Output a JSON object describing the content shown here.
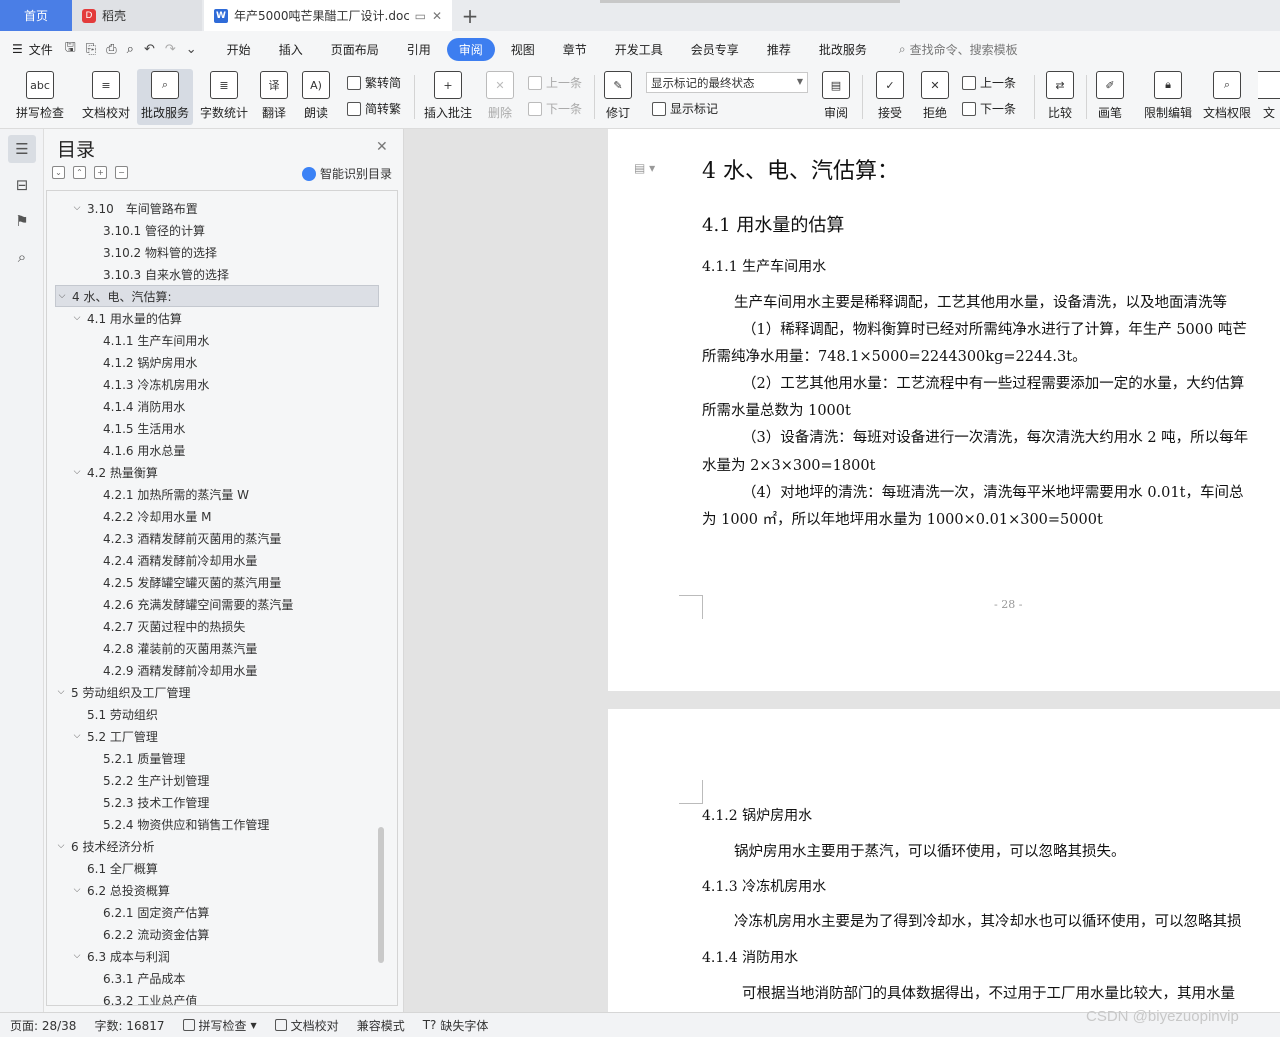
{
  "tabs": {
    "home": "首页",
    "docer": "稻壳",
    "doc": "年产5000吨芒果醋工厂设计.doc"
  },
  "menubar": {
    "file": "文件",
    "items": [
      "开始",
      "插入",
      "页面布局",
      "引用",
      "审阅",
      "视图",
      "章节",
      "开发工具",
      "会员专享",
      "推荐",
      "批改服务"
    ],
    "active": "审阅",
    "search": "查找命令、搜索模板"
  },
  "ribbon": {
    "spell_check": "拼写检查",
    "doc_proof": "文档校对",
    "review_service": "批改服务",
    "word_count": "字数统计",
    "translate": "翻译",
    "read_aloud": "朗读",
    "trad_convert": "繁转简",
    "simp_convert": "简转繁",
    "insert_comment": "插入批注",
    "delete": "删除",
    "prev_comment": "上一条",
    "next_comment": "下一条",
    "track_changes": "修订",
    "markup_state": "显示标记的最终状态",
    "show_markup": "显示标记",
    "review": "审阅",
    "accept": "接受",
    "reject": "拒绝",
    "prev_change": "上一条",
    "next_change": "下一条",
    "compare": "比较",
    "pen": "画笔",
    "restrict_edit": "限制编辑",
    "doc_permission": "文档权限",
    "doc_more": "文"
  },
  "toc": {
    "title": "目录",
    "smart": "智能识别目录",
    "items": [
      {
        "level": 2,
        "caret": "v",
        "text": "3.10　车间管路布置"
      },
      {
        "level": 3,
        "caret": "",
        "text": "3.10.1 管径的计算"
      },
      {
        "level": 3,
        "caret": "",
        "text": "3.10.2 物料管的选择"
      },
      {
        "level": 3,
        "caret": "",
        "text": "3.10.3 自来水管的选择"
      },
      {
        "level": 1,
        "caret": "v",
        "text": "4 水、电、汽估算:",
        "selected": true
      },
      {
        "level": 2,
        "caret": "v",
        "text": "4.1 用水量的估算"
      },
      {
        "level": 3,
        "caret": "",
        "text": "4.1.1 生产车间用水"
      },
      {
        "level": 3,
        "caret": "",
        "text": "4.1.2 锅炉房用水"
      },
      {
        "level": 3,
        "caret": "",
        "text": "4.1.3 冷冻机房用水"
      },
      {
        "level": 3,
        "caret": "",
        "text": "4.1.4 消防用水"
      },
      {
        "level": 3,
        "caret": "",
        "text": "4.1.5 生活用水"
      },
      {
        "level": 3,
        "caret": "",
        "text": "4.1.6 用水总量"
      },
      {
        "level": 2,
        "caret": "v",
        "text": "4.2 热量衡算"
      },
      {
        "level": 3,
        "caret": "",
        "text": "4.2.1 加热所需的蒸汽量 W"
      },
      {
        "level": 3,
        "caret": "",
        "text": "4.2.2 冷却用水量 M"
      },
      {
        "level": 3,
        "caret": "",
        "text": "4.2.3 酒精发酵前灭菌用的蒸汽量"
      },
      {
        "level": 3,
        "caret": "",
        "text": "4.2.4 酒精发酵前冷却用水量"
      },
      {
        "level": 3,
        "caret": "",
        "text": "4.2.5 发酵罐空罐灭菌的蒸汽用量"
      },
      {
        "level": 3,
        "caret": "",
        "text": "4.2.6 充满发酵罐空间需要的蒸汽量"
      },
      {
        "level": 3,
        "caret": "",
        "text": "4.2.7 灭菌过程中的热损失"
      },
      {
        "level": 3,
        "caret": "",
        "text": "4.2.8 灌装前的灭菌用蒸汽量"
      },
      {
        "level": 3,
        "caret": "",
        "text": "4.2.9 酒精发酵前冷却用水量"
      },
      {
        "level": 1,
        "caret": "v",
        "text": "5 劳动组织及工厂管理"
      },
      {
        "level": 2,
        "caret": "",
        "text": "5.1 劳动组织"
      },
      {
        "level": 2,
        "caret": "v",
        "text": "5.2 工厂管理"
      },
      {
        "level": 3,
        "caret": "",
        "text": "5.2.1 质量管理"
      },
      {
        "level": 3,
        "caret": "",
        "text": "5.2.2 生产计划管理"
      },
      {
        "level": 3,
        "caret": "",
        "text": "5.2.3 技术工作管理"
      },
      {
        "level": 3,
        "caret": "",
        "text": "5.2.4 物资供应和销售工作管理"
      },
      {
        "level": 1,
        "caret": "v",
        "text": "6 技术经济分析"
      },
      {
        "level": 2,
        "caret": "",
        "text": "6.1 全厂概算"
      },
      {
        "level": 2,
        "caret": "v",
        "text": "6.2 总投资概算"
      },
      {
        "level": 3,
        "caret": "",
        "text": "6.2.1 固定资产估算"
      },
      {
        "level": 3,
        "caret": "",
        "text": "6.2.2 流动资金估算"
      },
      {
        "level": 2,
        "caret": "v",
        "text": "6.3 成本与利润"
      },
      {
        "level": 3,
        "caret": "",
        "text": "6.3.1 产品成本"
      },
      {
        "level": 3,
        "caret": "",
        "text": "6.3.2 工业总产值"
      }
    ]
  },
  "doc": {
    "page1": {
      "h1": "4  水、电、汽估算：",
      "h2": "4.1 用水量的估算",
      "h3": "4.1.1 生产车间用水",
      "lines": [
        "生产车间用水主要是稀释调配，工艺其他用水量，设备清洗，以及地面清洗等",
        "（1）稀释调配，物料衡算时已经对所需纯净水进行了计算，年生产 5000 吨芒",
        "所需纯净水用量：748.1×5000=2244300kg=2244.3t。",
        "（2）工艺其他用水量：工艺流程中有一些过程需要添加一定的水量，大约估算",
        "所需水量总数为 1000t",
        "（3）设备清洗：每班对设备进行一次清洗，每次清洗大约用水 2 吨，所以每年",
        "水量为 2×3×300=1800t",
        "（4）对地坪的清洗：每班清洗一次，清洗每平米地坪需要用水 0.01t，车间总",
        "为 1000 ㎡，所以年地坪用水量为 1000×0.01×300=5000t"
      ],
      "page_number": "- 28 -"
    },
    "page2": {
      "h_boiler": "4.1.2  锅炉房用水",
      "p_boiler": "锅炉房用水主要用于蒸汽，可以循环使用，可以忽略其损失。",
      "h_freezer": "4.1.3  冷冻机房用水",
      "p_freezer": "冷冻机房用水主要是为了得到冷却水，其冷却水也可以循环使用，可以忽略其损",
      "h_fire": "4.1.4  消防用水",
      "p_fire": "可根据当地消防部门的具体数据得出，不过用于工厂用水量比较大，其用水量"
    }
  },
  "status": {
    "page": "页面: 28/38",
    "words": "字数: 16817",
    "spell": "拼写检查",
    "proof": "文档校对",
    "compat": "兼容模式",
    "missing_font": "缺失字体"
  },
  "watermark": "CSDN @biyezuopinvip"
}
